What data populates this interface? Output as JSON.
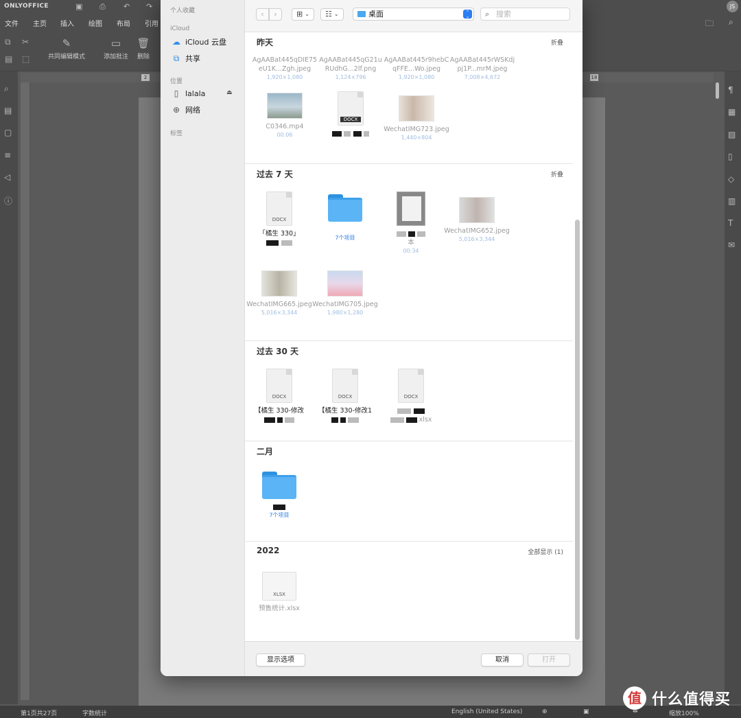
{
  "app": {
    "brand": "ONLYOFFICE",
    "avatar": "JS",
    "menu": [
      "文件",
      "主页",
      "插入",
      "绘图",
      "布局",
      "引用"
    ],
    "toolbar": {
      "coedit_label": "共同编辑模式",
      "add_comment_label": "添加批注",
      "delete_label": "删除"
    },
    "ruler_marks": [
      "2",
      "18"
    ],
    "status": {
      "page": "第1页共27页",
      "word_count": "字数统计",
      "language": "English (United States)",
      "zoom": "缩放100%"
    }
  },
  "dialog": {
    "sidebar": {
      "favorites_header": "个人收藏",
      "icloud_header": "iCloud",
      "icloud_drive": "iCloud 云盘",
      "shared": "共享",
      "locations_header": "位置",
      "location_disk": "lalala",
      "network": "网络",
      "tags_header": "标签"
    },
    "location": "桌面",
    "search_placeholder": "搜索",
    "sections": {
      "yesterday": {
        "title": "昨天",
        "action": "折叠",
        "row1": [
          {
            "name": "AgAABat445qDIE75eU1K...Zgh.jpeg",
            "meta": "1,920×1,080"
          },
          {
            "name": "AgAABat445qG21uRUdhG...2lf.png",
            "meta": "1,124×796"
          },
          {
            "name": "AgAABat445r9hebCqFFE...Wo.jpeg",
            "meta": "1,920×1,080"
          },
          {
            "name": "AgAABat445rWSKdjpj1P...mrM.jpeg",
            "meta": "7,008×4,672"
          }
        ],
        "row2": [
          {
            "name": "C0346.mp4",
            "meta": "00:06"
          },
          {
            "name": "",
            "meta": "",
            "doc_tag": "DOCX"
          },
          {
            "name": "WechatIMG723.jpeg",
            "meta": "1,440×804"
          }
        ]
      },
      "last7": {
        "title": "过去 7 天",
        "action": "折叠",
        "row1": [
          {
            "name": "「橘生 330」",
            "meta": "",
            "doc_tag": "DOCX"
          },
          {
            "name": "",
            "meta": "7个项目"
          },
          {
            "name": "",
            "meta": "00:34",
            "prefix": "本"
          },
          {
            "name": "WechatIMG652.jpeg",
            "meta": "5,016×3,344"
          }
        ],
        "row2": [
          {
            "name": "WechatIMG665.jpeg",
            "meta": "5,016×3,344"
          },
          {
            "name": "WechatIMG705.jpeg",
            "meta": "1,980×1,280"
          }
        ]
      },
      "last30": {
        "title": "过去 30 天",
        "row1": [
          {
            "name": "【橘生 330-修改",
            "doc_tag": "DOCX"
          },
          {
            "name": "【橘生 330-修改1",
            "doc_tag": "DOCX"
          },
          {
            "name": "",
            "doc_tag": "DOCX",
            "suffix": ".xlsx"
          }
        ]
      },
      "february": {
        "title": "二月",
        "row1": [
          {
            "name": "",
            "meta": "7个项目"
          }
        ]
      },
      "y2022": {
        "title": "2022",
        "action": "全部显示 (1)",
        "row1": [
          {
            "name": "预售统计.xlsx",
            "doc_tag": "XLSX"
          }
        ]
      }
    },
    "buttons": {
      "options": "显示选项",
      "cancel": "取消",
      "open": "打开"
    }
  },
  "watermark": {
    "logo_char": "值",
    "text": "什么值得买"
  }
}
